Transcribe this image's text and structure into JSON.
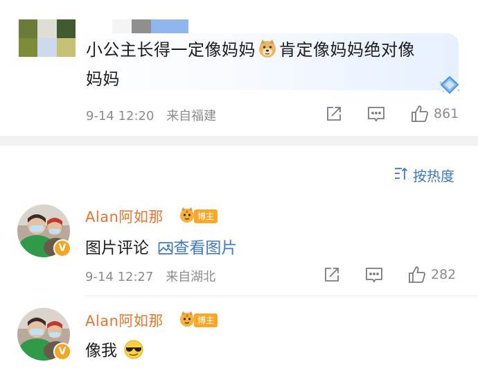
{
  "top_comment": {
    "mosaic_colors": [
      "#6b7c3a",
      "#e0ddd5",
      "#415a30",
      "#7d8c36",
      "#cdd9ee",
      "#c6c175"
    ],
    "text_line1": "小公主长得一定像妈妈",
    "text_line1b": "肯定像妈妈绝对像",
    "text_line2": "妈妈",
    "emoji_icon": "doge-emoji-icon",
    "date": "9-14 12:20",
    "location": "来自福建",
    "like_count": "861"
  },
  "sort": {
    "label": "按热度"
  },
  "replies": [
    {
      "username": "Alan阿如那",
      "badge": "博主",
      "text": "图片评论",
      "link_text": "查看图片",
      "date": "9-14 12:27",
      "location": "来自湖北",
      "like_count": "282"
    },
    {
      "username": "Alan阿如那",
      "badge": "博主",
      "text": "像我",
      "emoji_icon": "cool-sunglasses-emoji-icon"
    }
  ],
  "colors": {
    "accent_blue": "#3d78c2",
    "username_orange": "#e8742c",
    "badge_orange": "#f7a72a",
    "meta_gray": "#8c8c8c"
  }
}
